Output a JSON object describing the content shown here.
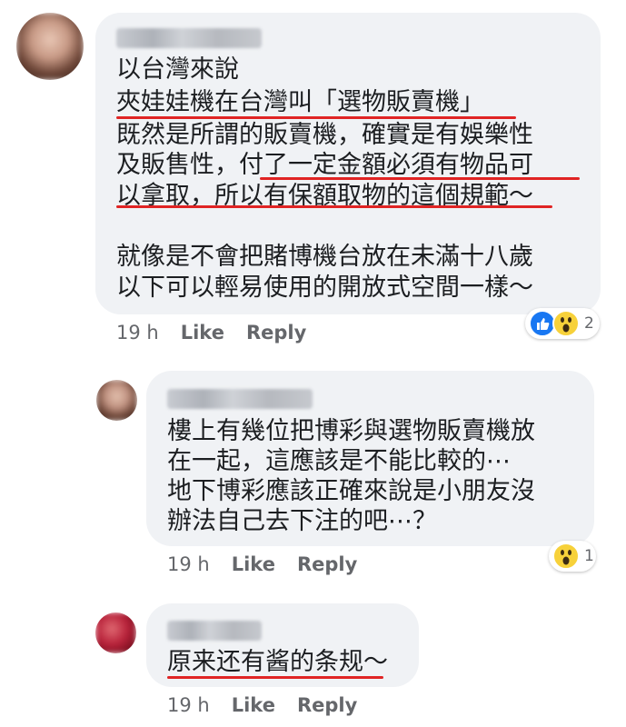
{
  "comments": [
    {
      "lines": [
        "以台灣來說",
        "夾娃娃機在台灣叫「選物販賣機」",
        "既然是所謂的販賣機，確實是有娛樂性",
        "及販售性，付了一定金額必須有物品可",
        "以拿取，所以有保額取物的這個規範～",
        "",
        "就像是不會把賭博機台放在未滿十八歲",
        "以下可以輕易使用的開放式空間一樣～"
      ],
      "time": "19 h",
      "like": "Like",
      "reply": "Reply",
      "reaction_count": "2",
      "reaction_icons": [
        "like-icon",
        "wow-icon"
      ]
    },
    {
      "lines": [
        "樓上有幾位把博彩與選物販賣機放",
        "在一起，這應該是不能比較的⋯",
        "地下博彩應該正確來說是小朋友沒",
        "辦法自己去下注的吧⋯？"
      ],
      "time": "19 h",
      "like": "Like",
      "reply": "Reply",
      "reaction_count": "1",
      "reaction_icons": [
        "wow-icon"
      ]
    },
    {
      "lines": [
        "原来还有酱的条规～"
      ],
      "time": "19 h",
      "like": "Like",
      "reply": "Reply"
    }
  ],
  "colors": {
    "bubble": "#f0f2f5",
    "underline": "#e02424",
    "meta": "#65676b",
    "like": "#1877f2",
    "wow": "#f7d13a"
  }
}
